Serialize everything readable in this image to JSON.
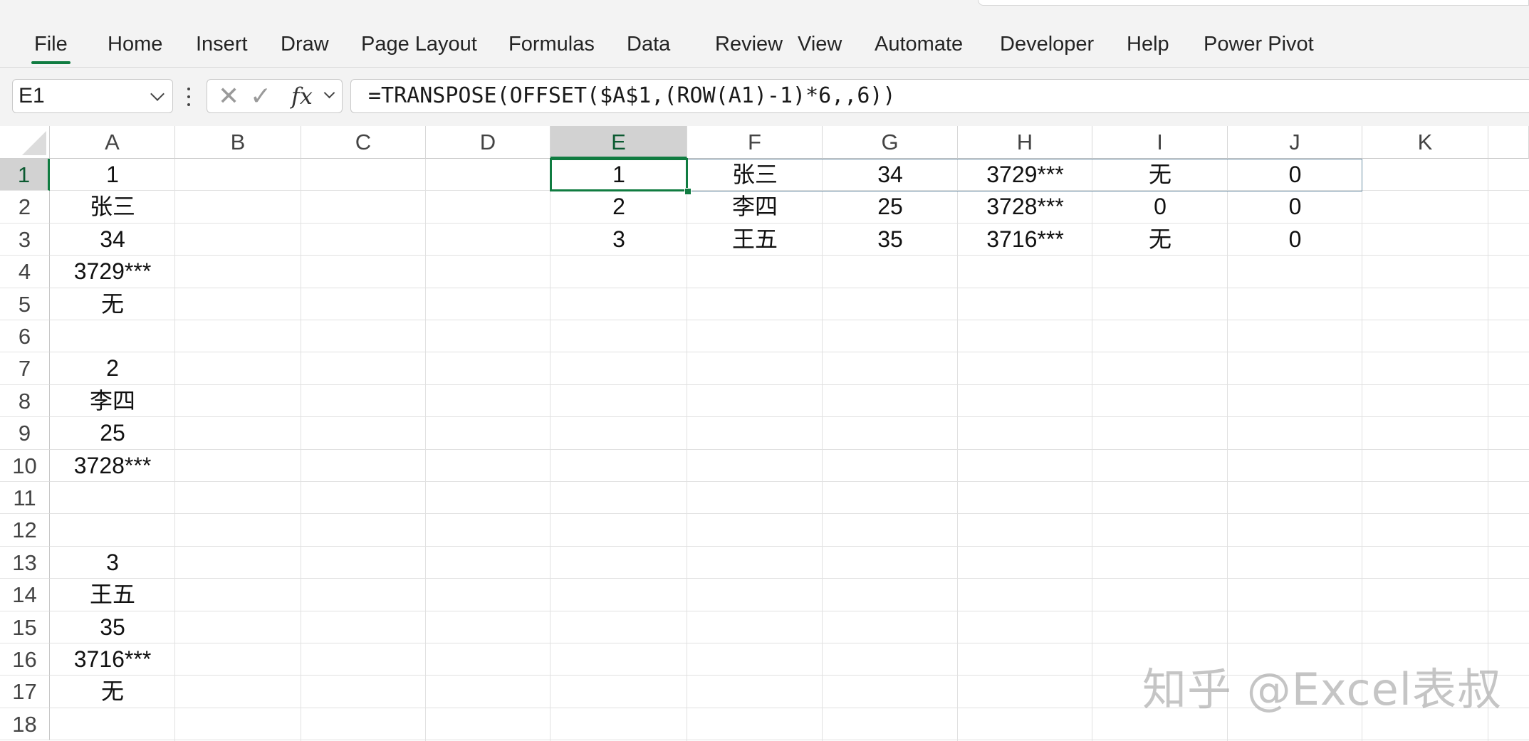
{
  "menu": [
    "File",
    "Home",
    "Insert",
    "Draw",
    "Page Layout",
    "Formulas",
    "Data",
    "Review",
    "View",
    "Automate",
    "Developer",
    "Help",
    "Power Pivot"
  ],
  "formula_bar": {
    "name_box": "E1",
    "fx": "fx",
    "formula": "=TRANSPOSE(OFFSET($A$1,(ROW(A1)-1)*6,,6))"
  },
  "columns": [
    "A",
    "B",
    "C",
    "D",
    "E",
    "F",
    "G",
    "H",
    "I",
    "J",
    "K"
  ],
  "rows": [
    "1",
    "2",
    "3",
    "4",
    "5",
    "6",
    "7",
    "8",
    "9",
    "10",
    "11",
    "12",
    "13",
    "14",
    "15",
    "16",
    "17",
    "18"
  ],
  "selected_column": "E",
  "selected_row": "1",
  "column_a": [
    "1",
    "张三",
    "34",
    "3729***",
    "无",
    "",
    "2",
    "李四",
    "25",
    "3728***",
    "",
    "",
    "3",
    "王五",
    "35",
    "3716***",
    "无",
    ""
  ],
  "result_table": [
    [
      "1",
      "张三",
      "34",
      "3729***",
      "无",
      "0"
    ],
    [
      "2",
      "李四",
      "25",
      "3728***",
      "0",
      "0"
    ],
    [
      "3",
      "王五",
      "35",
      "3716***",
      "无",
      "0"
    ]
  ],
  "watermark": "知乎 @Excel表叔",
  "colors": {
    "accent": "#107c41",
    "spill_border": "#6c8fa5"
  }
}
